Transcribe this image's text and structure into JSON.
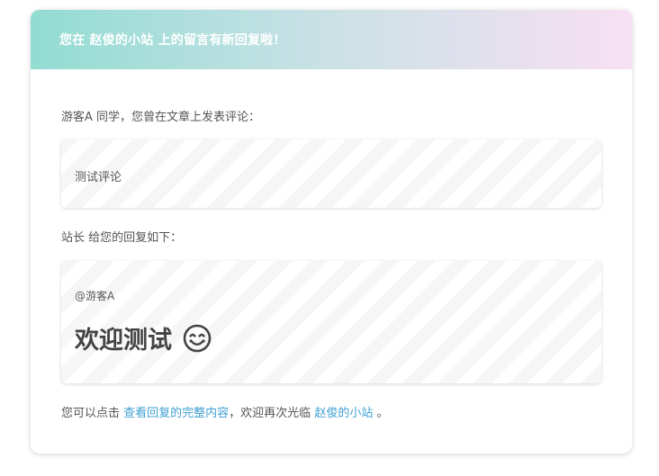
{
  "header": {
    "prefix": "您在",
    "site_name": "赵俊的小站",
    "suffix": "上的留言有新回复啦！"
  },
  "intro": {
    "user": "游客A",
    "text": "同学，您曾在文章上发表评论："
  },
  "comment": {
    "text": "测试评论"
  },
  "reply_intro": {
    "author": "站长",
    "text": "给您的回复如下："
  },
  "reply": {
    "mention": "@游客A",
    "message": "欢迎测试",
    "emoji_icon": "smile-icon"
  },
  "footer": {
    "prefix": "您可以点击",
    "link_label": "查看回复的完整内容",
    "middle": "，欢迎再次光临",
    "site_link_label": "赵俊的小站",
    "suffix": "。"
  },
  "colors": {
    "header_gradient_start": "#92dcd2",
    "header_gradient_end": "#f8e0f4",
    "link": "#3f9fd1",
    "text": "#555555"
  }
}
